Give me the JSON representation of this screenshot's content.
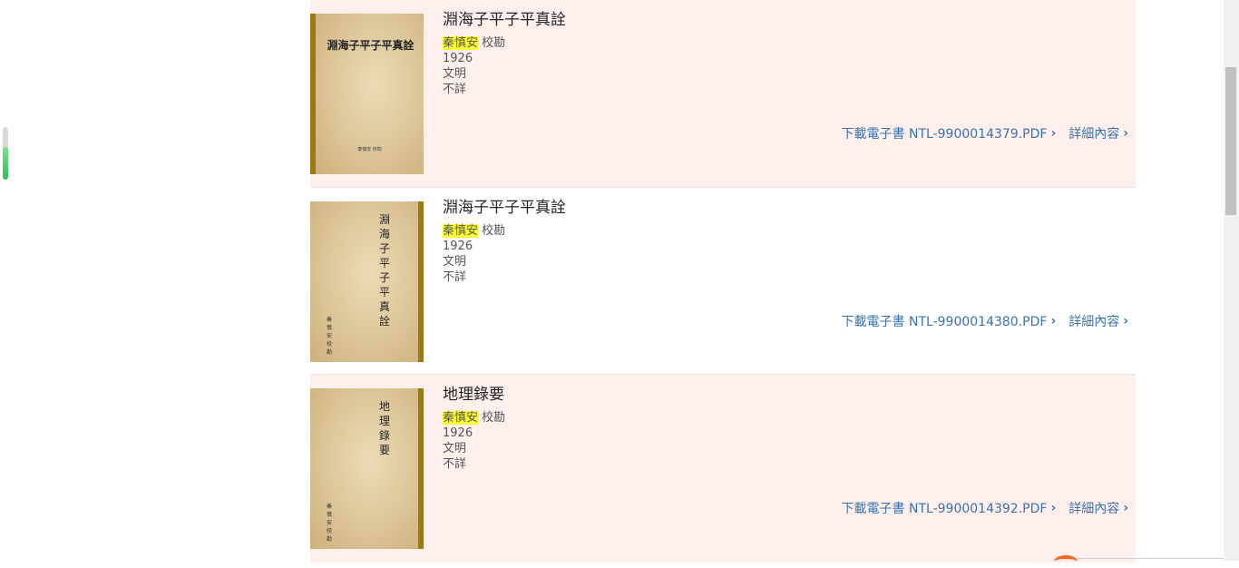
{
  "results": [
    {
      "title": "淵海子平子平真詮",
      "author": "秦慎安",
      "role": "校勘",
      "year": "1926",
      "publisher": "文明",
      "extra": "不詳",
      "download_label": "下載電子書 NTL-9900014379.PDF",
      "details_label": "詳細內容",
      "cover_title": "淵海子平子平真詮",
      "cover_author": "秦慎安 校勘"
    },
    {
      "title": "淵海子平子平真詮",
      "author": "秦慎安",
      "role": "校勘",
      "year": "1926",
      "publisher": "文明",
      "extra": "不詳",
      "download_label": "下載電子書 NTL-9900014380.PDF",
      "details_label": "詳細內容",
      "cover_title": "淵海子平子平真詮",
      "cover_author": "秦慎安 校勘"
    },
    {
      "title": "地理錄要",
      "author": "秦慎安",
      "role": "校勘",
      "year": "1926",
      "publisher": "文明",
      "extra": "不詳",
      "download_label": "下載電子書 NTL-9900014392.PDF",
      "details_label": "詳細內容",
      "cover_title": "地理錄要",
      "cover_author": "秦慎安 校勘"
    }
  ],
  "icons": {
    "link_chevron": "chevron-right-icon"
  },
  "colors": {
    "highlight": "#ffff33",
    "link": "#3a72ad",
    "row_tint": "#fff0ee",
    "cover_spine": "#9b7a14",
    "reading_progress": "#2fbf54"
  },
  "reading_progress": 0.62
}
